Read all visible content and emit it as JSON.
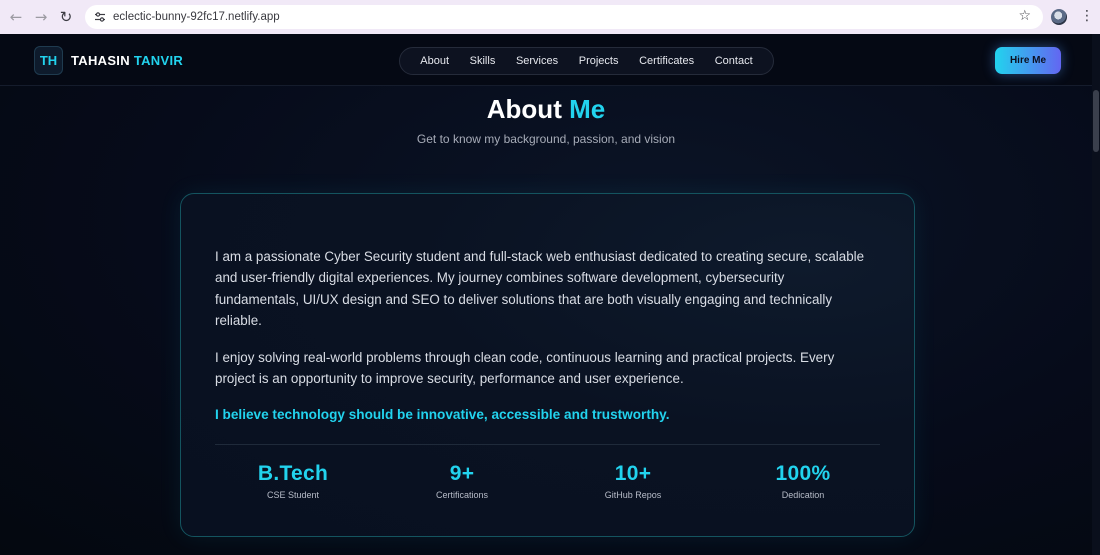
{
  "browser": {
    "url": "eclectic-bunny-92fc17.netlify.app"
  },
  "header": {
    "logo_initials": "TH",
    "logo_first": "TAHASIN",
    "logo_last": "TANVIR",
    "nav": [
      {
        "label": "About"
      },
      {
        "label": "Skills"
      },
      {
        "label": "Services"
      },
      {
        "label": "Projects"
      },
      {
        "label": "Certificates"
      },
      {
        "label": "Contact"
      }
    ],
    "hire_label": "Hire Me"
  },
  "about": {
    "title_main": "About",
    "title_accent": "Me",
    "subtitle": "Get to know my background, passion, and vision",
    "paragraph1": "I am a passionate Cyber Security student and full-stack web enthusiast dedicated to creating secure, scalable and user-friendly digital experiences. My journey combines software development, cybersecurity fundamentals, UI/UX design and SEO to deliver solutions that are both visually engaging and technically reliable.",
    "paragraph2": "I enjoy solving real-world problems through clean code, continuous learning and practical projects. Every project is an opportunity to improve security, performance and user experience.",
    "belief": "I believe technology should be innovative, accessible and trustworthy.",
    "stats": [
      {
        "value": "B.Tech",
        "label": "CSE Student"
      },
      {
        "value": "9+",
        "label": "Certifications"
      },
      {
        "value": "10+",
        "label": "GitHub Repos"
      },
      {
        "value": "100%",
        "label": "Dedication"
      }
    ]
  },
  "colors": {
    "accent": "#22d3ee",
    "background": "#050a18",
    "hire_gradient_end": "#6366f1"
  }
}
